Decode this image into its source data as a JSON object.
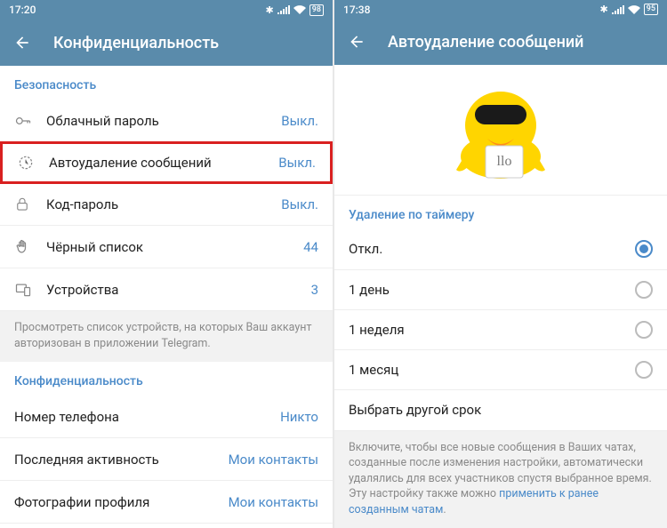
{
  "left": {
    "time": "17:20",
    "battery": "98",
    "title": "Конфиденциальность",
    "section_security": "Безопасность",
    "items": {
      "cloud_password": {
        "label": "Облачный пароль",
        "value": "Выкл."
      },
      "autodelete": {
        "label": "Автоудаление сообщений",
        "value": "Выкл."
      },
      "passcode": {
        "label": "Код-пароль",
        "value": "Выкл."
      },
      "blacklist": {
        "label": "Чёрный список",
        "value": "44"
      },
      "devices": {
        "label": "Устройства",
        "value": "3"
      }
    },
    "devices_hint": "Просмотреть список устройств, на которых Ваш аккаунт авторизован в приложении Telegram.",
    "section_privacy": "Конфиденциальность",
    "privacy": {
      "phone": {
        "label": "Номер телефона",
        "value": "Никто"
      },
      "lastseen": {
        "label": "Последняя активность",
        "value": "Мои контакты"
      },
      "photo": {
        "label": "Фотографии профиля",
        "value": "Мои контакты"
      }
    }
  },
  "right": {
    "time": "17:38",
    "battery": "95",
    "title": "Автоудаление сообщений",
    "sticker_text": "llo",
    "section": "Удаление по таймеру",
    "options": {
      "off": "Откл.",
      "day": "1 день",
      "week": "1 неделя",
      "month": "1 месяц",
      "other": "Выбрать другой срок"
    },
    "hint_prefix": "Включите, чтобы все новые сообщения в Ваших чатах, созданные после изменения настройки, автоматически удалялись для всех участников спустя выбранное время. Эту настройку также можно ",
    "hint_link": "применить к ранее созданным чатам",
    "hint_suffix": "."
  }
}
